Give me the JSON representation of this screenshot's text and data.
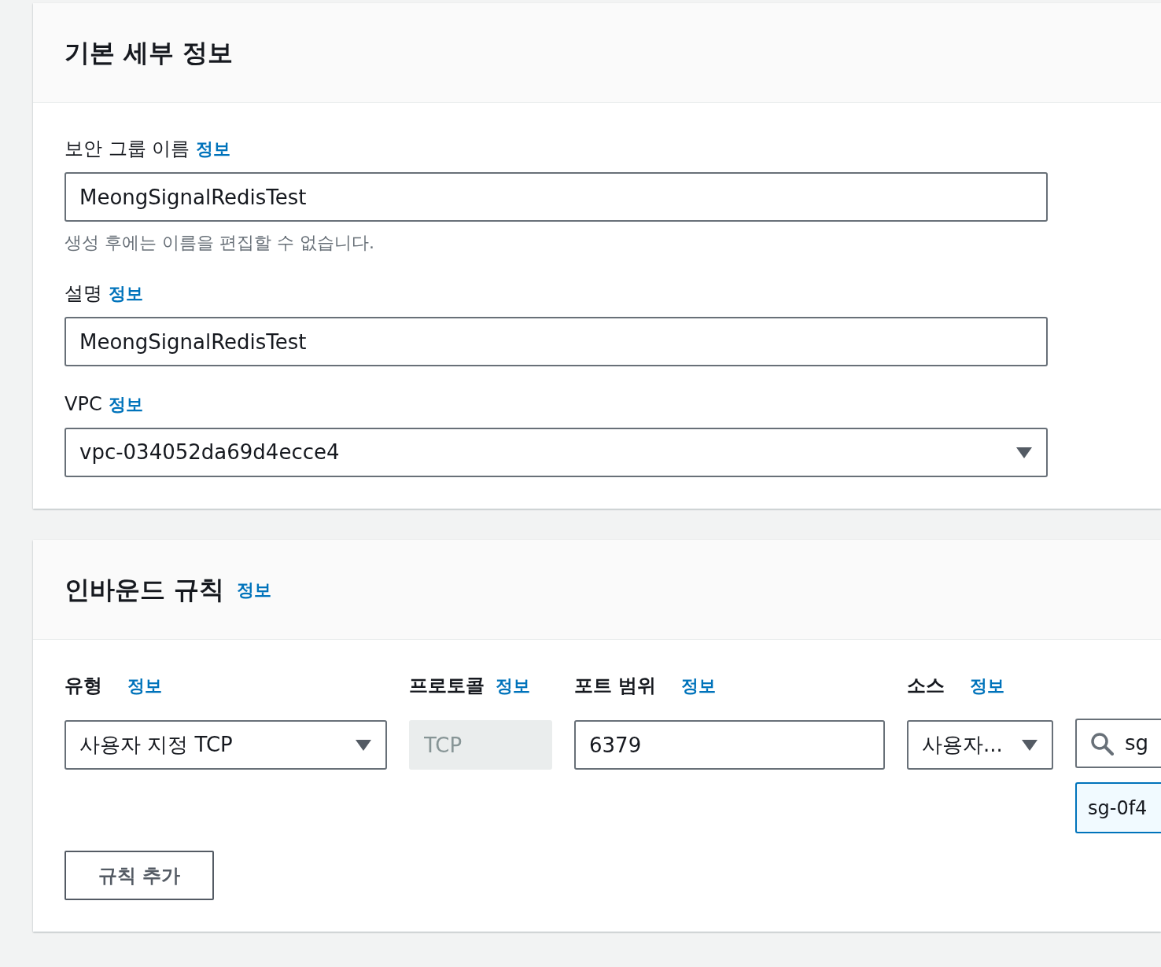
{
  "basic_details": {
    "title": "기본 세부 정보",
    "fields": [
      {
        "kind": "text",
        "label": "보안 그룹 이름",
        "info_link": "정보",
        "value": "MeongSignalRedisTest",
        "hint": "생성 후에는 이름을 편집할 수 없습니다."
      },
      {
        "kind": "text",
        "label": "설명",
        "info_link": "정보",
        "value": "MeongSignalRedisTest"
      },
      {
        "kind": "select",
        "label": "VPC",
        "info_link": "정보",
        "value": "vpc-034052da69d4ecce4"
      }
    ]
  },
  "inbound_rules": {
    "title": "인바운드 규칙",
    "info_link": "정보",
    "columns": [
      {
        "label": "유형",
        "info_link": "정보"
      },
      {
        "label": "프로토콜",
        "info_link": "정보"
      },
      {
        "label": "포트 범위",
        "info_link": "정보"
      },
      {
        "label": "소스",
        "info_link": "정보"
      }
    ],
    "rule": {
      "type": {
        "value": "사용자 지정 TCP"
      },
      "protocol": {
        "value": "TCP",
        "disabled": true
      },
      "port_range": {
        "value": "6379",
        "disabled": false
      },
      "source": {
        "value": "사용자..."
      },
      "source_search": {
        "value": "sg"
      },
      "source_token": {
        "label": "sg-0f4"
      }
    },
    "add_button": "규칙 추가"
  }
}
